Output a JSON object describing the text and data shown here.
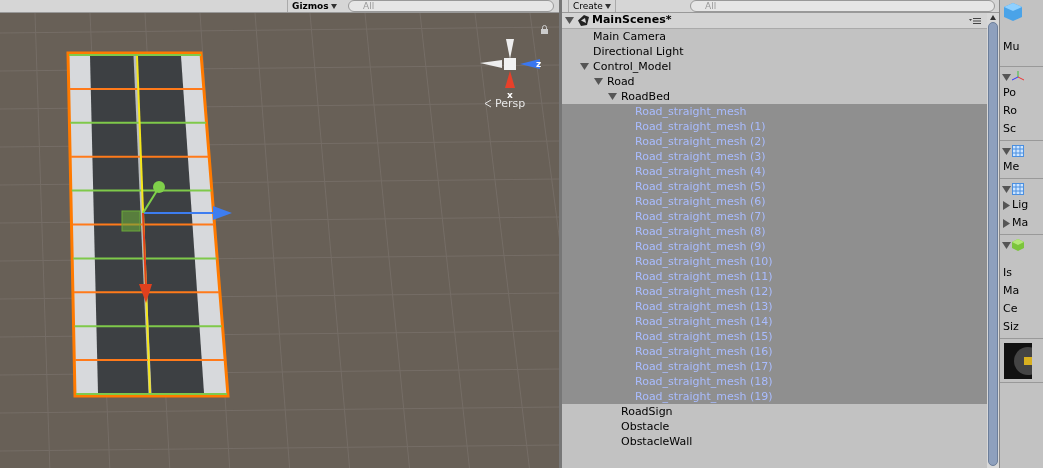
{
  "scene_toolbar": {
    "gizmos": "Gizmos",
    "search": {
      "placeholder": "All"
    }
  },
  "scene_view": {
    "axis_labels": [
      "z",
      "x"
    ],
    "projection": "Persp"
  },
  "hierarchy": {
    "create": "Create",
    "search": {
      "placeholder": "All"
    },
    "scene": "MainScenes*",
    "items": [
      {
        "label": "Main Camera",
        "selected": false
      },
      {
        "label": "Directional Light",
        "selected": false
      },
      {
        "label": "Control_Model",
        "selected": false,
        "expanded": true,
        "children": [
          {
            "label": "Road",
            "selected": false,
            "expanded": true,
            "children": [
              {
                "label": "RoadBed",
                "selected": false,
                "expanded": true,
                "children": [
                  {
                    "label": "Road_straight_mesh",
                    "selected": true
                  },
                  {
                    "label": "Road_straight_mesh (1)",
                    "selected": true
                  },
                  {
                    "label": "Road_straight_mesh (2)",
                    "selected": true
                  },
                  {
                    "label": "Road_straight_mesh (3)",
                    "selected": true
                  },
                  {
                    "label": "Road_straight_mesh (4)",
                    "selected": true
                  },
                  {
                    "label": "Road_straight_mesh (5)",
                    "selected": true
                  },
                  {
                    "label": "Road_straight_mesh (6)",
                    "selected": true
                  },
                  {
                    "label": "Road_straight_mesh (7)",
                    "selected": true
                  },
                  {
                    "label": "Road_straight_mesh (8)",
                    "selected": true
                  },
                  {
                    "label": "Road_straight_mesh (9)",
                    "selected": true
                  },
                  {
                    "label": "Road_straight_mesh (10)",
                    "selected": true
                  },
                  {
                    "label": "Road_straight_mesh (11)",
                    "selected": true
                  },
                  {
                    "label": "Road_straight_mesh (12)",
                    "selected": true
                  },
                  {
                    "label": "Road_straight_mesh (13)",
                    "selected": true
                  },
                  {
                    "label": "Road_straight_mesh (14)",
                    "selected": true
                  },
                  {
                    "label": "Road_straight_mesh (15)",
                    "selected": true
                  },
                  {
                    "label": "Road_straight_mesh (16)",
                    "selected": true
                  },
                  {
                    "label": "Road_straight_mesh (17)",
                    "selected": true
                  },
                  {
                    "label": "Road_straight_mesh (18)",
                    "selected": true
                  },
                  {
                    "label": "Road_straight_mesh (19)",
                    "selected": true
                  }
                ]
              },
              {
                "label": "RoadSign",
                "selected": false
              },
              {
                "label": "Obstacle",
                "selected": false
              },
              {
                "label": "ObstacleWall",
                "selected": false
              }
            ]
          }
        ]
      }
    ]
  },
  "inspector": {
    "header": "Mu",
    "sections": [
      {
        "kind": "component",
        "expanded": true,
        "rows": [
          {
            "label": "Po"
          },
          {
            "label": "Ro"
          },
          {
            "label": "Sc"
          }
        ]
      },
      {
        "kind": "component",
        "expanded": true,
        "rows": [
          {
            "label": "Me"
          }
        ]
      },
      {
        "kind": "component",
        "expanded": true,
        "rows": [
          {
            "label": "Lig",
            "expanded": false
          },
          {
            "label": "Ma",
            "expanded": false
          }
        ]
      },
      {
        "kind": "component",
        "expanded": true,
        "rows": [
          {
            "label": "Is"
          },
          {
            "label": "Ma"
          },
          {
            "label": "Ce"
          },
          {
            "label": "Siz"
          }
        ]
      },
      {
        "kind": "preview"
      }
    ]
  }
}
